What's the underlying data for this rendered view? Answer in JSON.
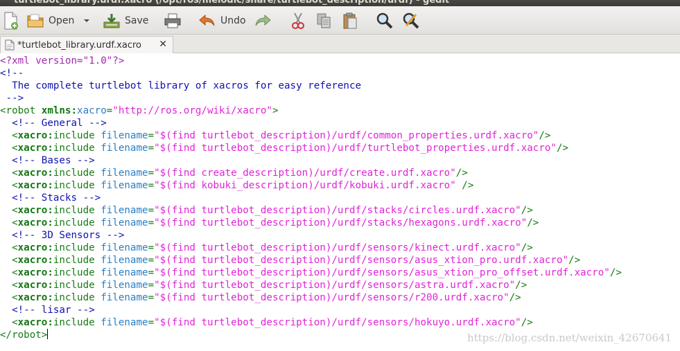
{
  "window": {
    "title": "turtlebot_library.urdf.xacro (/opt/ros/melodic/share/turtlebot_description/urdf) - gedit"
  },
  "toolbar": {
    "open_label": "Open",
    "save_label": "Save",
    "undo_label": "Undo",
    "icons": [
      "new-file-icon",
      "open-folder-icon",
      "dropdown-arrow-icon",
      "save-icon",
      "print-icon",
      "undo-icon",
      "redo-icon",
      "cut-icon",
      "copy-icon",
      "paste-icon",
      "search-icon",
      "replace-icon"
    ]
  },
  "tab": {
    "label": "*turtlebot_library.urdf.xacro",
    "close": "✕"
  },
  "code": {
    "colors": {
      "pi": "#a327b0",
      "comment": "#0e11b0",
      "tag": "#167b15",
      "string": "#e024d6",
      "attribute": "#2a7fc4"
    },
    "lines": [
      [
        [
          "pi",
          "<?xml version=\"1.0\"?>"
        ]
      ],
      [
        [
          "cmt",
          "<!--"
        ]
      ],
      [
        [
          "cmt",
          "  The complete turtlebot library of xacros for easy reference"
        ]
      ],
      [
        [
          "cmt",
          " -->"
        ]
      ],
      [
        [
          "tag",
          "<robot "
        ],
        [
          "ns",
          "xmlns:"
        ],
        [
          "attr",
          "xacro"
        ],
        [
          "tag",
          "="
        ],
        [
          "str",
          "\"http://ros.org/wiki/xacro\""
        ],
        [
          "tag",
          ">"
        ]
      ],
      [
        [
          "cmt",
          "  <!-- General -->"
        ]
      ],
      [
        [
          "tag",
          "  <"
        ],
        [
          "ns",
          "xacro:"
        ],
        [
          "tag",
          "include "
        ],
        [
          "attr",
          "filename"
        ],
        [
          "tag",
          "="
        ],
        [
          "str",
          "\"$(find turtlebot_description)/urdf/common_properties.urdf.xacro\""
        ],
        [
          "tag",
          "/>"
        ]
      ],
      [
        [
          "tag",
          "  <"
        ],
        [
          "ns",
          "xacro:"
        ],
        [
          "tag",
          "include "
        ],
        [
          "attr",
          "filename"
        ],
        [
          "tag",
          "="
        ],
        [
          "str",
          "\"$(find turtlebot_description)/urdf/turtlebot_properties.urdf.xacro\""
        ],
        [
          "tag",
          "/>"
        ]
      ],
      [
        [
          "cmt",
          "  <!-- Bases -->"
        ]
      ],
      [
        [
          "tag",
          "  <"
        ],
        [
          "ns",
          "xacro:"
        ],
        [
          "tag",
          "include "
        ],
        [
          "attr",
          "filename"
        ],
        [
          "tag",
          "="
        ],
        [
          "str",
          "\"$(find create_description)/urdf/create.urdf.xacro\""
        ],
        [
          "tag",
          "/>"
        ]
      ],
      [
        [
          "tag",
          "  <"
        ],
        [
          "ns",
          "xacro:"
        ],
        [
          "tag",
          "include "
        ],
        [
          "attr",
          "filename"
        ],
        [
          "tag",
          "="
        ],
        [
          "str",
          "\"$(find kobuki_description)/urdf/kobuki.urdf.xacro\""
        ],
        [
          "tag",
          " />"
        ]
      ],
      [
        [
          "cmt",
          "  <!-- Stacks -->"
        ]
      ],
      [
        [
          "tag",
          "  <"
        ],
        [
          "ns",
          "xacro:"
        ],
        [
          "tag",
          "include "
        ],
        [
          "attr",
          "filename"
        ],
        [
          "tag",
          "="
        ],
        [
          "str",
          "\"$(find turtlebot_description)/urdf/stacks/circles.urdf.xacro\""
        ],
        [
          "tag",
          "/>"
        ]
      ],
      [
        [
          "tag",
          "  <"
        ],
        [
          "ns",
          "xacro:"
        ],
        [
          "tag",
          "include "
        ],
        [
          "attr",
          "filename"
        ],
        [
          "tag",
          "="
        ],
        [
          "str",
          "\"$(find turtlebot_description)/urdf/stacks/hexagons.urdf.xacro\""
        ],
        [
          "tag",
          "/>"
        ]
      ],
      [
        [
          "cmt",
          "  <!-- 3D Sensors -->"
        ]
      ],
      [
        [
          "tag",
          "  <"
        ],
        [
          "ns",
          "xacro:"
        ],
        [
          "tag",
          "include "
        ],
        [
          "attr",
          "filename"
        ],
        [
          "tag",
          "="
        ],
        [
          "str",
          "\"$(find turtlebot_description)/urdf/sensors/kinect.urdf.xacro\""
        ],
        [
          "tag",
          "/>"
        ]
      ],
      [
        [
          "tag",
          "  <"
        ],
        [
          "ns",
          "xacro:"
        ],
        [
          "tag",
          "include "
        ],
        [
          "attr",
          "filename"
        ],
        [
          "tag",
          "="
        ],
        [
          "str",
          "\"$(find turtlebot_description)/urdf/sensors/asus_xtion_pro.urdf.xacro\""
        ],
        [
          "tag",
          "/>"
        ]
      ],
      [
        [
          "tag",
          "  <"
        ],
        [
          "ns",
          "xacro:"
        ],
        [
          "tag",
          "include "
        ],
        [
          "attr",
          "filename"
        ],
        [
          "tag",
          "="
        ],
        [
          "str",
          "\"$(find turtlebot_description)/urdf/sensors/asus_xtion_pro_offset.urdf.xacro\""
        ],
        [
          "tag",
          "/>"
        ]
      ],
      [
        [
          "tag",
          "  <"
        ],
        [
          "ns",
          "xacro:"
        ],
        [
          "tag",
          "include "
        ],
        [
          "attr",
          "filename"
        ],
        [
          "tag",
          "="
        ],
        [
          "str",
          "\"$(find turtlebot_description)/urdf/sensors/astra.urdf.xacro\""
        ],
        [
          "tag",
          "/>"
        ]
      ],
      [
        [
          "tag",
          "  <"
        ],
        [
          "ns",
          "xacro:"
        ],
        [
          "tag",
          "include "
        ],
        [
          "attr",
          "filename"
        ],
        [
          "tag",
          "="
        ],
        [
          "str",
          "\"$(find turtlebot_description)/urdf/sensors/r200.urdf.xacro\""
        ],
        [
          "tag",
          "/>"
        ]
      ],
      [
        [
          "cmt",
          "  <!-- lisar -->"
        ]
      ],
      [
        [
          "tag",
          "  <"
        ],
        [
          "ns",
          "xacro:"
        ],
        [
          "tag",
          "include "
        ],
        [
          "attr",
          "filename"
        ],
        [
          "tag",
          "="
        ],
        [
          "str",
          "\"$(find turtlebot_description)/urdf/sensors/hokuyo.urdf.xacro\""
        ],
        [
          "tag",
          "/>"
        ]
      ],
      [
        [
          "tag",
          "</robot>"
        ]
      ]
    ]
  },
  "watermark": "https://blog.csdn.net/weixin_42670641"
}
